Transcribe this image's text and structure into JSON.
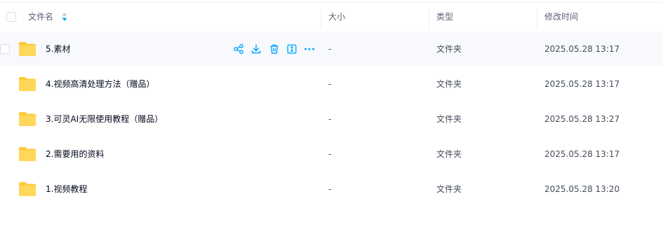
{
  "header": {
    "name": "文件名",
    "size": "大小",
    "type": "类型",
    "modified": "修改时间"
  },
  "rows": [
    {
      "name": "5.素材",
      "size": "-",
      "type": "文件夹",
      "modified": "2025.05.28 13:17"
    },
    {
      "name": "4.视频高清处理方法（赠品）",
      "size": "-",
      "type": "文件夹",
      "modified": "2025.05.28 13:17"
    },
    {
      "name": "3.可灵AI无限使用教程（赠品）",
      "size": "-",
      "type": "文件夹",
      "modified": "2025.05.28 13:27"
    },
    {
      "name": "2.需要用的资料",
      "size": "-",
      "type": "文件夹",
      "modified": "2025.05.28 13:17"
    },
    {
      "name": "1.视频教程",
      "size": "-",
      "type": "文件夹",
      "modified": "2025.05.28 13:20"
    }
  ],
  "row_actions": [
    "share-icon",
    "download-icon",
    "delete-icon",
    "rename-icon",
    "more-icon"
  ],
  "colors": {
    "accent": "#06a7ff",
    "folder_back": "#ffc935",
    "folder_front": "#ffd75a",
    "hover_row": "#f7f9fc"
  }
}
